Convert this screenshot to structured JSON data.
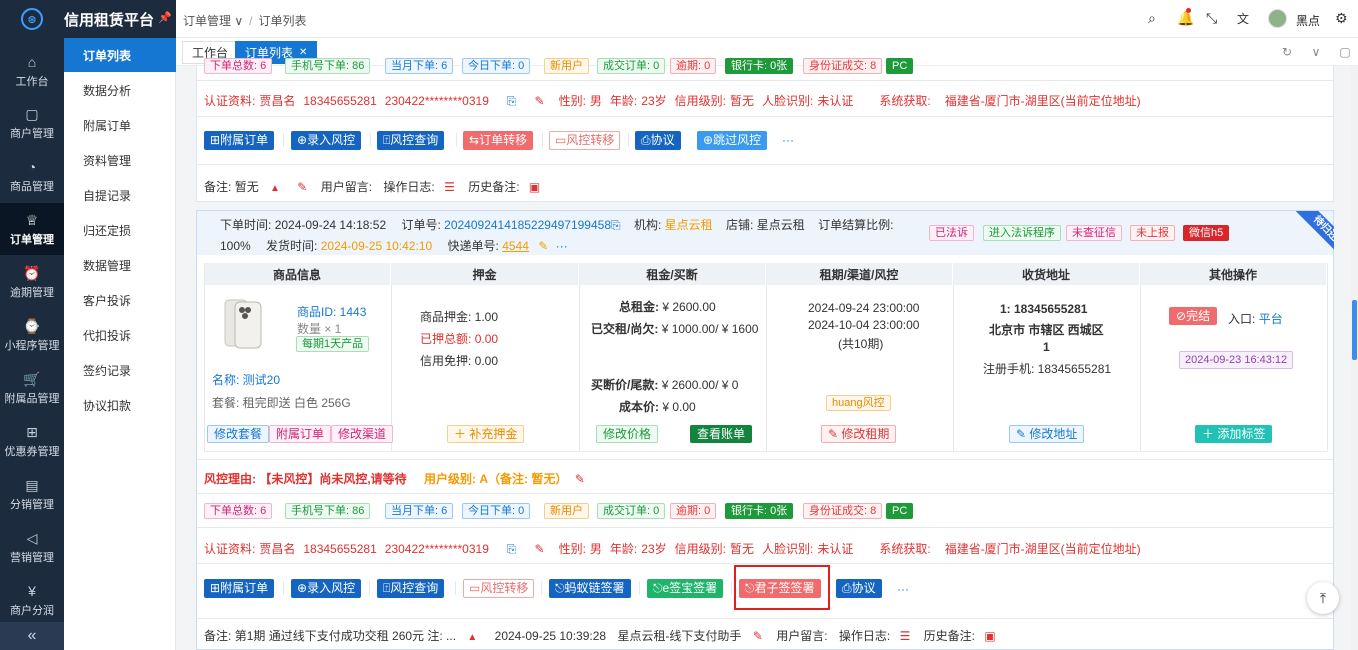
{
  "app": {
    "title": "信用租赁平台"
  },
  "rail": [
    {
      "label": "工作台",
      "icon": "home-icon",
      "glyph": "⌂"
    },
    {
      "label": "商户管理",
      "icon": "bag-icon",
      "glyph": "▢"
    },
    {
      "label": "商品管理",
      "icon": "apple-icon",
      "glyph": "◔"
    },
    {
      "label": "订单管理",
      "icon": "trophy-icon",
      "glyph": "♕"
    },
    {
      "label": "逾期管理",
      "icon": "alarm-icon",
      "glyph": "⏰"
    },
    {
      "label": "小程序管理",
      "icon": "watch-icon",
      "glyph": "⌚"
    },
    {
      "label": "附属品管理",
      "icon": "cart-icon",
      "glyph": "🛒"
    },
    {
      "label": "优惠券管理",
      "icon": "gift-icon",
      "glyph": "⊞"
    },
    {
      "label": "分销管理",
      "icon": "chart-icon",
      "glyph": "▤"
    },
    {
      "label": "营销管理",
      "icon": "megaphone-icon",
      "glyph": "◁"
    },
    {
      "label": "商户分润",
      "icon": "yen-icon",
      "glyph": "¥"
    }
  ],
  "submenu": [
    "订单列表",
    "数据分析",
    "附属订单",
    "资料管理",
    "自提记录",
    "归还定损",
    "数据管理",
    "客户投诉",
    "代扣投诉",
    "签约记录",
    "协议扣款"
  ],
  "breadcrumb": {
    "parent": "订单管理",
    "current": "订单列表"
  },
  "user": {
    "name": "黑点"
  },
  "tabs": [
    "工作台",
    "订单列表"
  ],
  "top_card": {
    "tags": [
      "下单总数: 6",
      "手机号下单: 86",
      "当月下单: 6",
      "今日下单: 0",
      "新用户",
      "成交订单: 0",
      "逾期: 0",
      "银行卡: 0张",
      "身份证成交: 8",
      "PC"
    ],
    "cert": {
      "label": "认证资料:",
      "name": "贾昌名",
      "phone": "18345655281",
      "idno": "230422********0319",
      "gender_label": "性别:",
      "gender": "男",
      "age_label": "年龄:",
      "age": "23岁",
      "credit_label": "信用级别:",
      "credit": "暂无",
      "face_label": "人脸识别:",
      "face": "未认证",
      "sys_label": "系统获取:",
      "sys": "福建省-厦门市-湖里区(当前定位地址)"
    },
    "buttons": [
      "附属订单",
      "录入风控",
      "风控查询",
      "订单转移",
      "风控转移",
      "协议",
      "跳过风控"
    ],
    "more": "···",
    "remark": {
      "label": "备注:",
      "value": "暂无",
      "msg": "用户留言:",
      "log": "操作日志:",
      "hist": "历史备注:"
    }
  },
  "order": {
    "time_label": "下单时间:",
    "time": "2024-09-24 14:18:52",
    "no_label": "订单号:",
    "no": "20240924141852294971994​58",
    "org_label": "机构:",
    "org": "星点云租",
    "shop_label": "店铺:",
    "shop": "星点云租",
    "ratio_label": "订单结算比例:",
    "ratio": "100%",
    "ship_label": "发货时间:",
    "ship": "2024-09-25 10:42:10",
    "express_label": "快递单号:",
    "express": "4544",
    "badges": [
      "已法诉",
      "进入法诉程序",
      "未查征信",
      "未上报",
      "微信h5"
    ],
    "ribbon": "待归还",
    "headers": [
      "商品信息",
      "押金",
      "租金/买断",
      "租期/渠道/风控",
      "收货地址",
      "其他操作"
    ],
    "product": {
      "id": "商品ID: 1443",
      "qty": "数量 × 1",
      "tag": "每期1天产品",
      "name": "名称: 测试20",
      "pkg": "套餐: 租完即送 白色 256G"
    },
    "product_btns": [
      "修改套餐",
      "附属订单",
      "修改渠道"
    ],
    "deposit": {
      "goods": "商品押金: 1.00",
      "paid_label": "已押总额:",
      "paid": "0.00",
      "credit": "信用免押: 0.00",
      "btn": "补充押金"
    },
    "rent": {
      "total_label": "总租金:",
      "total": "¥ 2600.00",
      "paid_label": "已交租/尚欠:",
      "paid": "¥ 1000.00/ ¥ 1600",
      "buyout_label": "买断价/尾款:",
      "buyout": "¥ 2600.00/ ¥ 0",
      "cost_label": "成本价:",
      "cost": "¥ 0.00",
      "btn1": "修改价格",
      "btn2": "查看账单"
    },
    "term": {
      "start": "2024-09-24 23:00:00",
      "end": "2024-10-04 23:00:00",
      "periods": "(共10期)",
      "risk": "huang风控",
      "btn": "修改租期"
    },
    "address": {
      "line1": "1:  18345655281",
      "line2": "北京市 市辖区 西城区",
      "line3": "1",
      "phone": "注册手机:  18345655281",
      "btn": "修改地址"
    },
    "ops": {
      "done": "完结",
      "entry": "入口:",
      "entry_val": "平台",
      "date": "2024-09-23 16:43:12",
      "btn": "添加标签"
    },
    "risk_reason": {
      "label": "风控理由:",
      "value": "【未风控】尚未风控,请等待",
      "level_label": "用户级别:",
      "level": "A（备注: 暂无）"
    },
    "tags": [
      "下单总数: 6",
      "手机号下单: 86",
      "当月下单: 6",
      "今日下单: 0",
      "新用户",
      "成交订单: 0",
      "逾期: 0",
      "银行卡: 0张",
      "身份证成交: 8",
      "PC"
    ],
    "cert": {
      "label": "认证资料:",
      "name": "贾昌名",
      "phone": "18345655281",
      "idno": "230422********0319",
      "gender_label": "性别:",
      "gender": "男",
      "age_label": "年龄:",
      "age": "23岁",
      "credit_label": "信用级别:",
      "credit": "暂无",
      "face_label": "人脸识别:",
      "face": "未认证",
      "sys_label": "系统获取:",
      "sys": "福建省-厦门市-湖里区(当前定位地址)"
    },
    "buttons": [
      "附属订单",
      "录入风控",
      "风控查询",
      "风控转移",
      "蚂蚁链签署",
      "e签宝签署",
      "君子签签署",
      "协议"
    ],
    "more": "···",
    "remark": {
      "label": "备注:",
      "value": "第1期 通过线下支付成功交租 260元 注: ...",
      "time": "2024-09-25 10:39:28",
      "who": "星点云租-线下支付助手",
      "msg": "用户留言:",
      "log": "操作日志:",
      "hist": "历史备注:"
    }
  },
  "colors": {
    "accent": "#1677d2",
    "highlight_box": "#e02020"
  }
}
